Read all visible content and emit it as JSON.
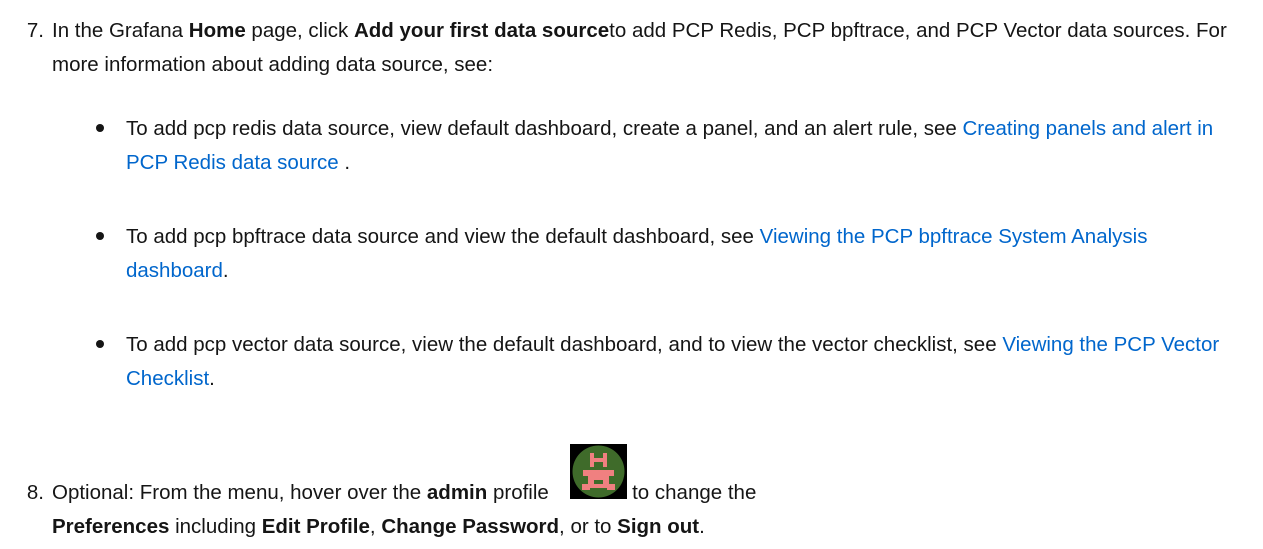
{
  "steps": [
    {
      "number": "7.",
      "parts": [
        "In the Grafana ",
        "Home",
        " page, click ",
        "Add your first data source",
        "to add PCP Redis, PCP bpftrace, and PCP Vector data sources. For more information about adding data source, see:"
      ],
      "bullets": [
        {
          "text": "To add pcp redis data source, view default dashboard, create a panel, and an alert rule, see ",
          "link": "Creating panels and alert in PCP Redis data source",
          "tail": " ."
        },
        {
          "text": "To add pcp bpftrace data source and view the default dashboard, see ",
          "link": "Viewing the PCP bpftrace System Analysis dashboard",
          "tail": "."
        },
        {
          "text": "To add pcp vector data source, view the default dashboard, and to view the vector checklist, see ",
          "link": "Viewing the PCP Vector Checklist",
          "tail": "."
        }
      ]
    },
    {
      "number": "8.",
      "parts": [
        "Optional: From the menu, hover over the ",
        "admin",
        " profile",
        "icon to change the ",
        "Preferences",
        " including ",
        "Edit Profile",
        ", ",
        "Change Password",
        ", or to ",
        "Sign out",
        "."
      ],
      "icon": "admin-avatar-icon"
    }
  ],
  "colors": {
    "text": "#151515",
    "link": "#0066cc",
    "avatar_bg": "#3f6b2a",
    "avatar_fg": "#f08080"
  }
}
